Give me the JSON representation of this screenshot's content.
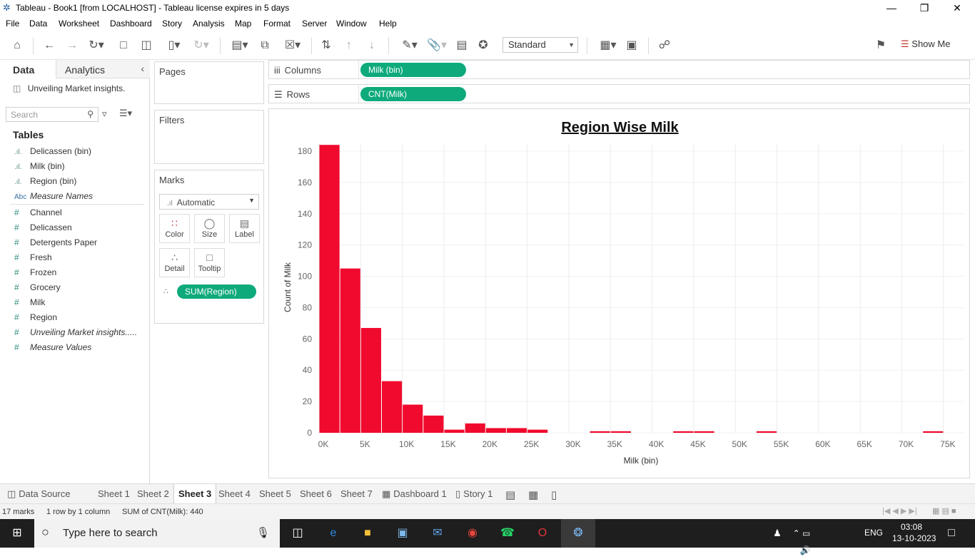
{
  "window": {
    "title": "Tableau - Book1 [from LOCALHOST] - Tableau license expires in 5 days"
  },
  "menu": [
    "File",
    "Data",
    "Worksheet",
    "Dashboard",
    "Story",
    "Analysis",
    "Map",
    "Format",
    "Server",
    "Window",
    "Help"
  ],
  "toolbar": {
    "view_mode": "Standard",
    "show_me_label": "Show Me"
  },
  "datapane": {
    "tab_data": "Data",
    "tab_analytics": "Analytics",
    "datasource": "Unveiling Market insights.",
    "search_placeholder": "Search",
    "tables_heading": "Tables",
    "dimensions": [
      {
        "icon": ".ıl.",
        "label": "Delicassen (bin)"
      },
      {
        "icon": ".ıl.",
        "label": "Milk (bin)"
      },
      {
        "icon": ".ıl.",
        "label": "Region (bin)"
      },
      {
        "icon": "Abc",
        "label": "Measure Names"
      }
    ],
    "measures": [
      {
        "label": "Channel"
      },
      {
        "label": "Delicassen"
      },
      {
        "label": "Detergents Paper"
      },
      {
        "label": "Fresh"
      },
      {
        "label": "Frozen"
      },
      {
        "label": "Grocery"
      },
      {
        "label": "Milk"
      },
      {
        "label": "Region"
      },
      {
        "label": "Unveiling Market insights....."
      },
      {
        "label": "Measure Values"
      }
    ]
  },
  "shelves": {
    "pages": "Pages",
    "filters": "Filters",
    "marks": "Marks",
    "mark_type": "Automatic",
    "mark_buttons": [
      "Color",
      "Size",
      "Label",
      "Detail",
      "Tooltip"
    ],
    "marks_pill": "SUM(Region)",
    "columns_label": "Columns",
    "columns_pill": "Milk (bin)",
    "rows_label": "Rows",
    "rows_pill": "CNT(Milk)"
  },
  "chart_data": {
    "type": "bar",
    "title": "Region Wise Milk",
    "xlabel": "Milk (bin)",
    "ylabel": "Count of Milk",
    "bin_size": 2500,
    "x_ticks": [
      "0K",
      "5K",
      "10K",
      "15K",
      "20K",
      "25K",
      "30K",
      "35K",
      "40K",
      "45K",
      "50K",
      "55K",
      "60K",
      "65K",
      "70K",
      "75K"
    ],
    "y_ticks": [
      0,
      20,
      40,
      60,
      80,
      100,
      120,
      140,
      160,
      180
    ],
    "ylim": [
      0,
      185
    ],
    "bars": [
      {
        "x": 0,
        "value": 184
      },
      {
        "x": 2500,
        "value": 105
      },
      {
        "x": 5000,
        "value": 67
      },
      {
        "x": 7500,
        "value": 33
      },
      {
        "x": 10000,
        "value": 18
      },
      {
        "x": 12500,
        "value": 11
      },
      {
        "x": 15000,
        "value": 2
      },
      {
        "x": 17500,
        "value": 6
      },
      {
        "x": 20000,
        "value": 3
      },
      {
        "x": 22500,
        "value": 3
      },
      {
        "x": 25000,
        "value": 2
      },
      {
        "x": 32500,
        "value": 1
      },
      {
        "x": 35000,
        "value": 1
      },
      {
        "x": 42500,
        "value": 1
      },
      {
        "x": 45000,
        "value": 1
      },
      {
        "x": 52500,
        "value": 1
      },
      {
        "x": 72500,
        "value": 1
      }
    ],
    "bar_color": "#f00a2d",
    "grid": true
  },
  "sheet_tabs": {
    "datasource": "Data Source",
    "sheets": [
      "Sheet 1",
      "Sheet 2",
      "Sheet 3",
      "Sheet 4",
      "Sheet 5",
      "Sheet 6",
      "Sheet 7"
    ],
    "active": "Sheet 3",
    "dashboard": "Dashboard 1",
    "story": "Story 1"
  },
  "status": {
    "marks": "17 marks",
    "rows_cols": "1 row by 1 column",
    "sum": "SUM of CNT(Milk): 440"
  },
  "taskbar": {
    "search_placeholder": "Type here to search",
    "lang": "ENG",
    "time": "03:08",
    "date": "13-10-2023"
  }
}
